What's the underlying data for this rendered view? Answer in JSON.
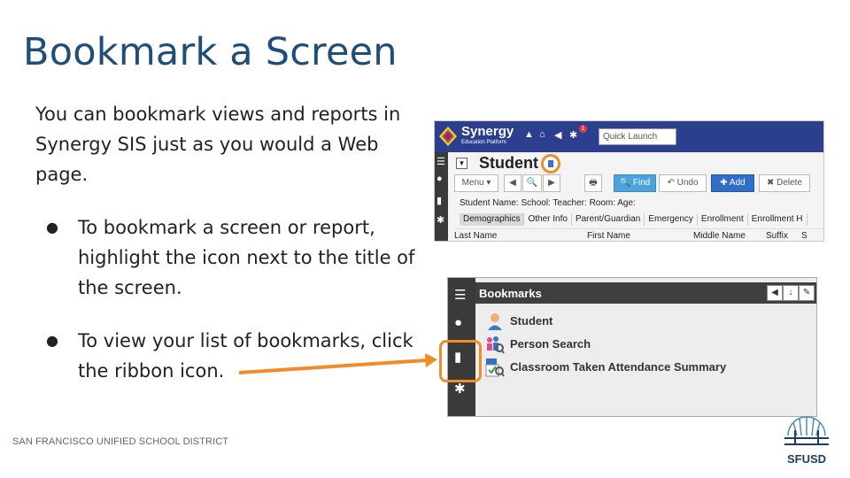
{
  "slide": {
    "title": "Bookmark a Screen",
    "intro": "You can bookmark views and reports in Synergy SIS just as you would a Web page.",
    "bullets": [
      "To bookmark a screen or report, highlight the icon next to the title of the screen.",
      "To view your list of bookmarks, click the ribbon icon."
    ],
    "bullet_glyph": "●",
    "footer": "SAN FRANCISCO UNIFIED SCHOOL DISTRICT",
    "logo_text": "SFUSD"
  },
  "synergy_top": {
    "brand": "Synergy",
    "brand_sub": "Education Platform",
    "badge": "1",
    "quick_launch_placeholder": "Quick Launch",
    "page_title": "Student",
    "toolbar": {
      "menu": "Menu ▾",
      "prev": "◀",
      "search": "🔍",
      "next": "▶",
      "print": "🖶",
      "find": "🔍 Find",
      "undo": "↶ Undo",
      "add": "✚ Add",
      "delete": "✖ Delete"
    },
    "info": "Student Name:  School:  Teacher:  Room:  Age:",
    "tabs": [
      "Demographics",
      "Other Info",
      "Parent/Guardian",
      "Emergency",
      "Enrollment",
      "Enrollment H"
    ],
    "columns": [
      "Last Name",
      "First Name",
      "Middle Name",
      "Suffix",
      "S"
    ]
  },
  "synergy_bookmarks": {
    "title": "Bookmarks",
    "items": [
      {
        "label": "Student",
        "icon": "student-icon"
      },
      {
        "label": "Person Search",
        "icon": "person-search-icon"
      },
      {
        "label": "Classroom Taken Attendance Summary",
        "icon": "attendance-report-icon"
      }
    ]
  },
  "colors": {
    "title_blue": "#1f4e79",
    "highlight_orange": "#f28c28",
    "synergy_navy": "#2c3f8f",
    "rail_dark": "#3a3a3a"
  }
}
